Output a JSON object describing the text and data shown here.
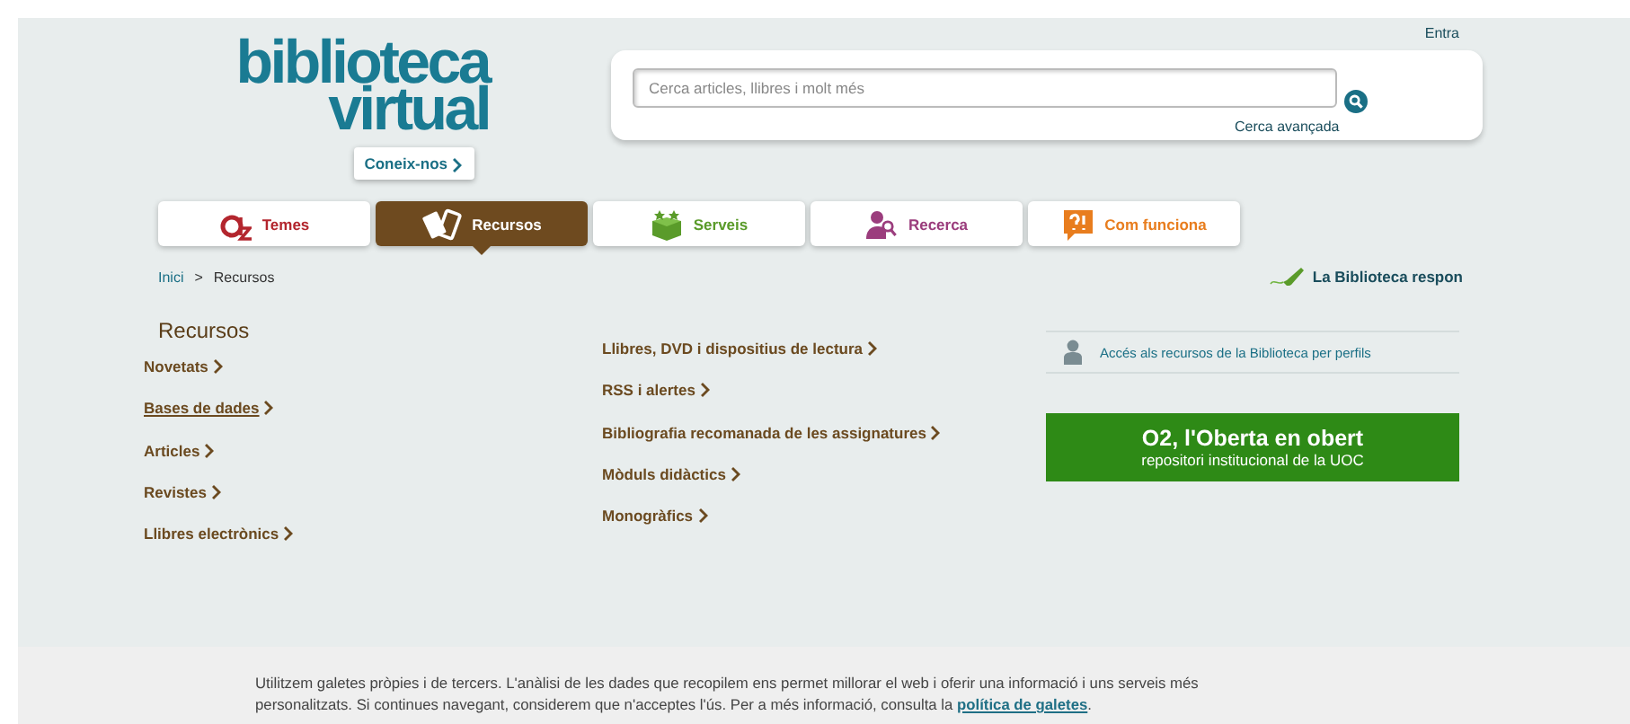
{
  "header": {
    "login": "Entra",
    "logo_line1": "biblioteca",
    "logo_line2": "virtual",
    "about_button": "Coneix-nos",
    "search": {
      "placeholder": "Cerca articles, llibres i molt més",
      "advanced": "Cerca avançada"
    }
  },
  "tabs": [
    {
      "label": "Temes",
      "kind": "az",
      "color": "#b3262e",
      "selected": false
    },
    {
      "label": "Recursos",
      "kind": "devices",
      "color": "#ffffff",
      "selected": true
    },
    {
      "label": "Serveis",
      "kind": "box",
      "color": "#5a9b2a",
      "selected": false
    },
    {
      "label": "Recerca",
      "kind": "person",
      "color": "#9b3d7d",
      "selected": false
    },
    {
      "label": "Com funciona",
      "kind": "question",
      "color": "#e87d1e",
      "selected": false
    }
  ],
  "breadcrumb": [
    "Inici",
    "Recursos"
  ],
  "breadcrumb_separator": ">",
  "help_link": "La Biblioteca respon",
  "section_title": "Recursos",
  "left_links": [
    {
      "label": "Novetats",
      "selected": false
    },
    {
      "label": "Bases de dades",
      "selected": true
    },
    {
      "label": "Articles",
      "selected": false
    },
    {
      "label": "Revistes",
      "selected": false
    },
    {
      "label": "Llibres electrònics",
      "selected": false
    }
  ],
  "middle_links": [
    "Llibres, DVD i dispositius de lectura",
    "RSS i alertes",
    "Bibliografia recomanada de les assignatures",
    "Mòduls didàctics",
    "Monogràfics"
  ],
  "profile_link": "Accés als recursos de la Biblioteca per perfils",
  "banner": {
    "title": "O2, l'Oberta en obert",
    "subtitle": "repositori institucional de la UOC"
  },
  "cookie_notice": {
    "text": "Utilitzem galetes pròpies i de tercers. L'anàlisi de les dades que recopilem ens permet millorar el web i oferir una informació i uns serveis més personalitzats. Si continues navegant, considerem que n'acceptes l'ús. Per a més informació, consulta la",
    "link": "política de galetes",
    "end": "."
  }
}
